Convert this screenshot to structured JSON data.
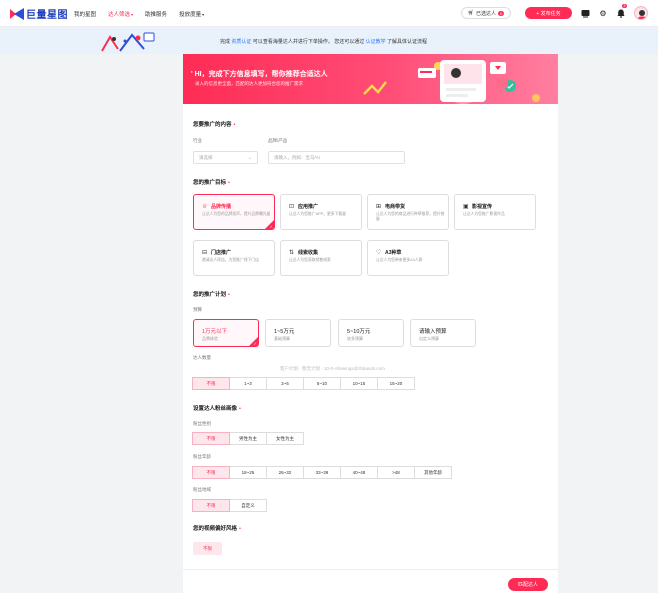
{
  "nav": {
    "logo_text": "巨量星图",
    "items": [
      {
        "label": "我的星图",
        "active": false,
        "caret": false
      },
      {
        "label": "达人筛选",
        "active": true,
        "caret": true
      },
      {
        "label": "助推服务",
        "active": false,
        "caret": false
      },
      {
        "label": "投放度量",
        "active": false,
        "caret": true
      }
    ],
    "caret_glyph": "▾",
    "invited_label": "已选达人",
    "invited_count": "0",
    "publish_label": "+ 发布任务",
    "notification_count": "3",
    "accent": "#fe2c55"
  },
  "notice": {
    "prefix": "完成",
    "link1": "资质认证",
    "mid": "可以查看海量达人并进行下单操作。 您还可以通过",
    "link2": "认证教学",
    "suffix": "了解具体认证流程"
  },
  "banner": {
    "title": "HI，完成下方信息填写，帮你推荐合适达人",
    "subtitle": "录入的信息更全面，匹配的达人更加符合您的推广需求"
  },
  "promo_content": {
    "title": "您要推广的内容",
    "required_mark": "•",
    "industry_label": "行业",
    "industry_placeholder": "请选择",
    "brand_label": "品牌/产品",
    "brand_placeholder": "请输入，例如：宝马/AI"
  },
  "goal": {
    "title": "您的推广目标",
    "cards": [
      {
        "icon": "crown-icon",
        "glyph": "♕",
        "title": "品牌传播",
        "desc": "让达人为您的品牌发声，提升品牌曝光量",
        "selected": true
      },
      {
        "icon": "app-icon",
        "glyph": "⊡",
        "title": "应用推广",
        "desc": "让达人为您推广APP，更多下载量",
        "selected": false
      },
      {
        "icon": "shop-icon",
        "glyph": "⊞",
        "title": "电商带货",
        "desc": "让达人为您的商品进行种草推荐，提升销量",
        "selected": false
      },
      {
        "icon": "film-icon",
        "glyph": "▣",
        "title": "影视宣传",
        "desc": "让达人为您推广影视作品",
        "selected": false
      },
      {
        "icon": "store-icon",
        "glyph": "⊟",
        "title": "门店推广",
        "desc": "邀请达人探店，为您推广线下门店",
        "selected": false
      },
      {
        "icon": "lead-icon",
        "glyph": "⇅",
        "title": "线索收集",
        "desc": "让达人为您获取销售线索",
        "selected": false
      },
      {
        "icon": "a3-icon",
        "glyph": "♡",
        "title": "A3种草",
        "desc": "让达人为您带来更多A3人群",
        "selected": false
      }
    ]
  },
  "plan": {
    "title": "您的推广计划",
    "budget_label": "预算",
    "budgets": [
      {
        "title": "1万元以下",
        "desc": "品牌体验",
        "selected": true
      },
      {
        "title": "1~5万元",
        "desc": "基础预算",
        "selected": false
      },
      {
        "title": "5~10万元",
        "desc": "较多预算",
        "selected": false
      },
      {
        "title": "请输入预算",
        "desc": "自定义预算",
        "selected": false
      }
    ],
    "count_label": "达人数量",
    "ghost_text": "客户计划 · 暂无计划 · 10-0-Allowings@zbbands.com",
    "counts": [
      "不限",
      "1~3",
      "3~5",
      "5~10",
      "10~15",
      "15~20"
    ],
    "count_selected": 0
  },
  "persona": {
    "title": "设置达人粉丝画像",
    "gender_label": "粉丝性别",
    "genders": [
      "不限",
      "男性为主",
      "女性为主"
    ],
    "age_label": "粉丝年龄",
    "ages": [
      "不限",
      "18~25",
      "26~32",
      "33~39",
      "40~48",
      ">48",
      "其他年龄"
    ],
    "region_label": "粉丝地域",
    "regions": [
      "不限",
      "自定义"
    ]
  },
  "style": {
    "title": "您的视频偏好风格",
    "option": "不限"
  },
  "footer": {
    "next_label": "匹配达人"
  }
}
